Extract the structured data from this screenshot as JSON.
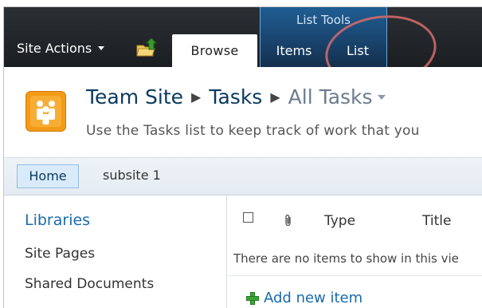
{
  "ribbon": {
    "site_actions_label": "Site Actions",
    "contextual_group_label": "List Tools",
    "tabs": [
      {
        "label": "Browse",
        "selected": true
      },
      {
        "label": "Items",
        "selected": false
      },
      {
        "label": "List",
        "selected": false
      }
    ]
  },
  "title_area": {
    "breadcrumb": [
      "Team Site",
      "Tasks",
      "All Tasks"
    ],
    "description": "Use the Tasks list to keep track of work that you"
  },
  "top_nav": {
    "items": [
      {
        "label": "Home",
        "selected": true
      },
      {
        "label": "subsite 1",
        "selected": false
      }
    ]
  },
  "quick_launch": {
    "heading": "Libraries",
    "items": [
      "Site Pages",
      "Shared Documents",
      ""
    ]
  },
  "list_view": {
    "columns": [
      "Type",
      "Title"
    ],
    "empty_message": "There are no items to show in this vie",
    "add_new_label": "Add new item"
  },
  "colors": {
    "ribbon_dark": "#1b1e21",
    "contextual_blue": "#19426b",
    "link_blue": "#1a6aad",
    "logo_orange": "#f39a17",
    "annotation_red": "#d86c6c"
  },
  "icons": [
    "navigate-up-icon",
    "site-logo-icon",
    "attachment-icon",
    "plus-icon",
    "dropdown-caret-icon"
  ]
}
